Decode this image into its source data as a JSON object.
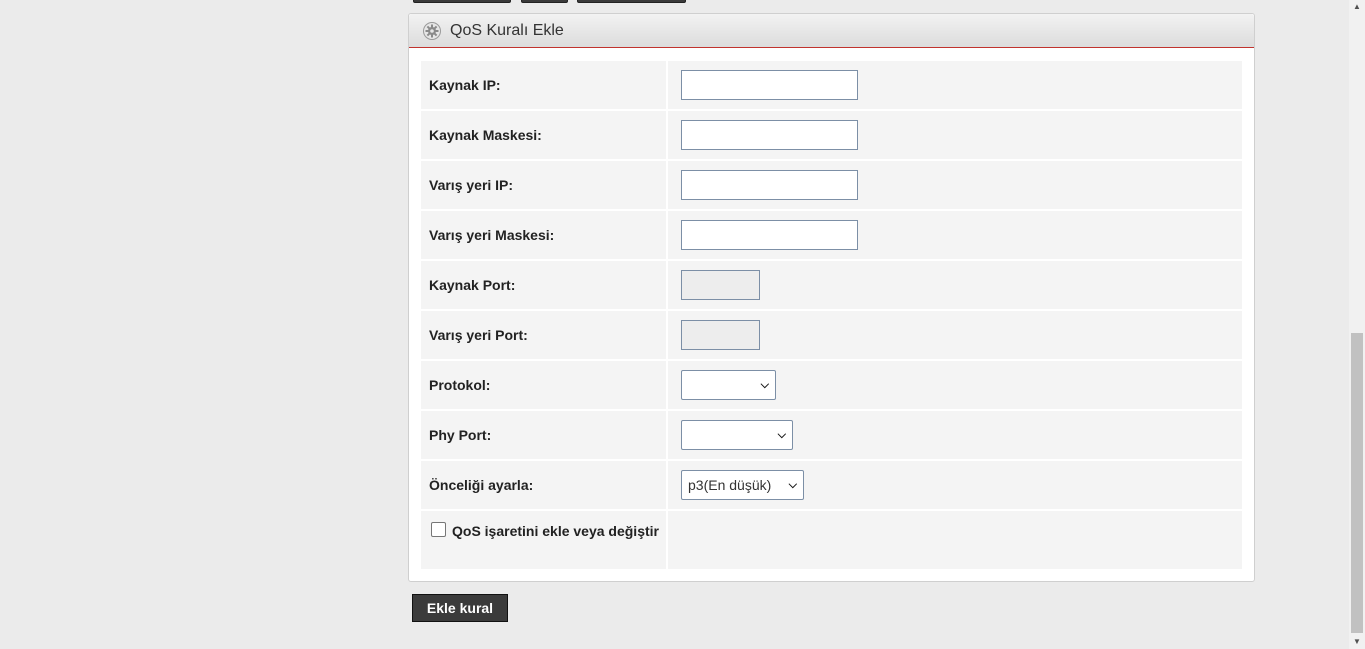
{
  "panel": {
    "title": "QoS Kuralı Ekle",
    "icon": "gear-icon"
  },
  "form": {
    "source_ip": {
      "label": "Kaynak IP:",
      "value": ""
    },
    "source_mask": {
      "label": "Kaynak Maskesi:",
      "value": ""
    },
    "dest_ip": {
      "label": "Varış yeri IP:",
      "value": ""
    },
    "dest_mask": {
      "label": "Varış yeri Maskesi:",
      "value": ""
    },
    "source_port": {
      "label": "Kaynak Port:",
      "value": ""
    },
    "dest_port": {
      "label": "Varış yeri Port:",
      "value": ""
    },
    "protocol": {
      "label": "Protokol:",
      "selected": ""
    },
    "phy_port": {
      "label": "Phy Port:",
      "selected": ""
    },
    "priority": {
      "label": "Önceliği ayarla:",
      "selected": "p3(En düşük)"
    },
    "qos_mark": {
      "label": "QoS işaretini ekle veya değiştir",
      "checked": false
    }
  },
  "actions": {
    "submit_label": "Ekle kural"
  },
  "colors": {
    "header_accent": "#c1332e",
    "button_bg": "#3b3b3b"
  }
}
